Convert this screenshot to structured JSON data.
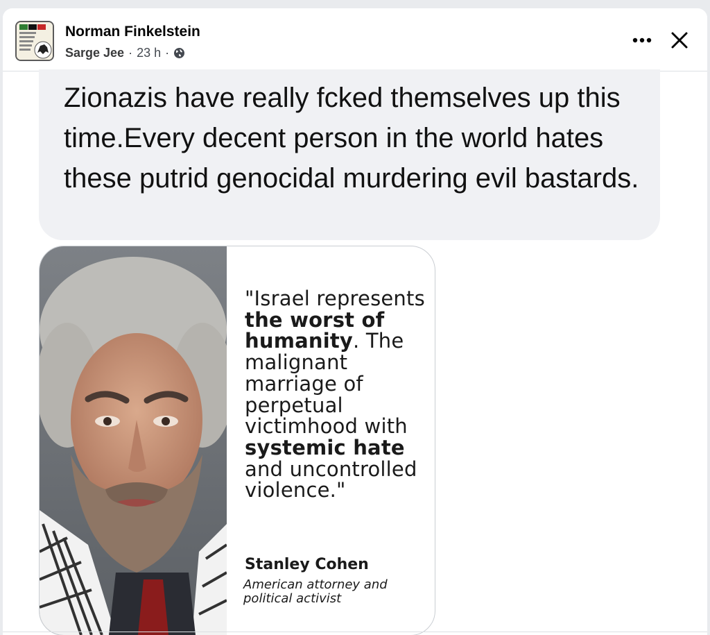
{
  "post": {
    "group_name": "Norman Finkelstein",
    "author": "Sarge Jee",
    "separator": "·",
    "time": "23 h",
    "privacy_icon": "globe-icon",
    "text": "Zionazis have really fcked themselves up this time.Every decent person in the world hates these putrid genocidal murdering evil bastards."
  },
  "header": {
    "more_icon": "more-horizontal-icon",
    "close_icon": "close-icon"
  },
  "image_card": {
    "quote_parts": [
      {
        "text": "\"Israel represents ",
        "bold": false
      },
      {
        "text": "the worst of humanity",
        "bold": true
      },
      {
        "text": ". The malignant marriage of perpetual victimhood with ",
        "bold": false
      },
      {
        "text": "systemic hate",
        "bold": true
      },
      {
        "text": " and uncontrolled violence.\"",
        "bold": false
      }
    ],
    "speaker_name": "Stanley Cohen",
    "speaker_title": "American attorney and political activist"
  },
  "colors": {
    "bubble_bg": "#f0f1f4",
    "text": "#111111",
    "meta": "#444950"
  }
}
